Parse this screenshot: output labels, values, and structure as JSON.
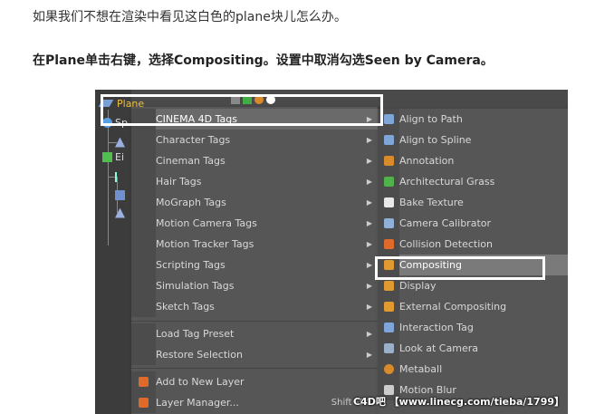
{
  "article": {
    "intro": "如果我们不想在渲染中看见这白色的plane块儿怎么办。",
    "instruction": "在Plane单击右键，选择Compositing。设置中取消勾选Seen by Camera。"
  },
  "object_manager": {
    "plane_label": "Plane",
    "row_labels": [
      "Sp",
      "Ei"
    ]
  },
  "context_menu": {
    "items": [
      {
        "label": "CINEMA 4D Tags",
        "submenu": true,
        "highlighted": true
      },
      {
        "label": "Character Tags",
        "submenu": true
      },
      {
        "label": "Cineman Tags",
        "submenu": true
      },
      {
        "label": "Hair Tags",
        "submenu": true
      },
      {
        "label": "MoGraph Tags",
        "submenu": true
      },
      {
        "label": "Motion Camera Tags",
        "submenu": true
      },
      {
        "label": "Motion Tracker Tags",
        "submenu": true
      },
      {
        "label": "Scripting Tags",
        "submenu": true
      },
      {
        "label": "Simulation Tags",
        "submenu": true
      },
      {
        "label": "Sketch Tags",
        "submenu": true
      },
      {
        "label": "Load Tag Preset",
        "submenu": true
      },
      {
        "label": "Restore Selection",
        "submenu": true
      },
      {
        "label": "Add to New Layer",
        "submenu": false
      },
      {
        "label": "Layer Manager...",
        "submenu": false,
        "shortcut": "Shift+F4"
      }
    ],
    "arrow_glyph": "▶"
  },
  "tag_submenu": {
    "items": [
      {
        "label": "Align to Path",
        "icon": "align-path-icon",
        "color": "#7fa6d9"
      },
      {
        "label": "Align to Spline",
        "icon": "align-spline-icon",
        "color": "#7fa6d9"
      },
      {
        "label": "Annotation",
        "icon": "annotation-icon",
        "color": "#d98a2b"
      },
      {
        "label": "Architectural Grass",
        "icon": "grass-icon",
        "color": "#4fb24a"
      },
      {
        "label": "Bake Texture",
        "icon": "bake-texture-icon",
        "color": "#e8e8e8"
      },
      {
        "label": "Camera Calibrator",
        "icon": "camera-calibrator-icon",
        "color": "#8fb0d8"
      },
      {
        "label": "Collision Detection",
        "icon": "collision-icon",
        "color": "#e06a2a"
      },
      {
        "label": "Compositing",
        "icon": "compositing-icon",
        "color": "#e09a30",
        "highlighted": true
      },
      {
        "label": "Display",
        "icon": "display-icon",
        "color": "#e09a30"
      },
      {
        "label": "External Compositing",
        "icon": "external-compositing-icon",
        "color": "#e09a30"
      },
      {
        "label": "Interaction Tag",
        "icon": "interaction-icon",
        "color": "#7fa6d9"
      },
      {
        "label": "Look at Camera",
        "icon": "look-at-camera-icon",
        "color": "#9ab0c8"
      },
      {
        "label": "Metaball",
        "icon": "metaball-icon",
        "color": "#d98a2b"
      },
      {
        "label": "Motion Blur",
        "icon": "motion-blur-icon",
        "color": "#cccccc"
      }
    ]
  },
  "watermark": "C4D吧 【www.linecg.com/tieba/1799】"
}
